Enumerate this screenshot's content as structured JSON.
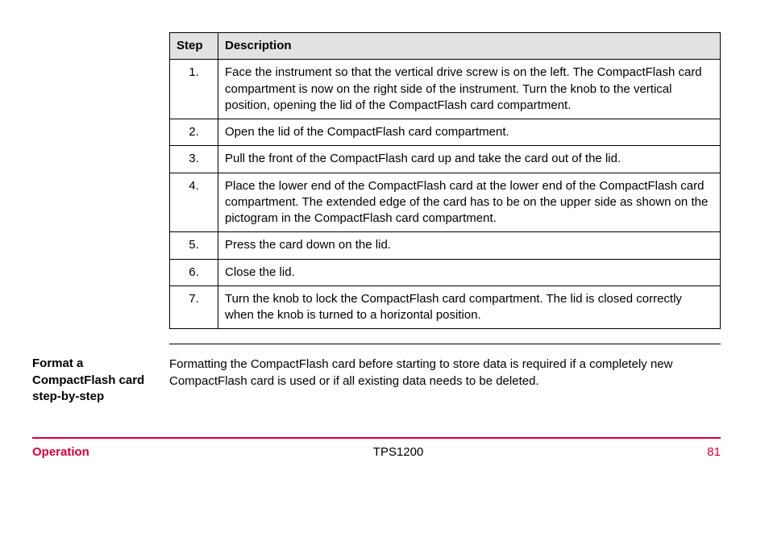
{
  "table": {
    "headers": [
      "Step",
      "Description"
    ],
    "rows": [
      {
        "step": "1.",
        "desc": "Face the instrument so that the vertical drive screw is on the left. The CompactFlash card compartment is now on the right side of the instrument. Turn the knob to the vertical position, opening the lid of the CompactFlash card compartment."
      },
      {
        "step": "2.",
        "desc": "Open the lid of the CompactFlash card compartment."
      },
      {
        "step": "3.",
        "desc": "Pull the front of the CompactFlash card up and take the card out of the lid."
      },
      {
        "step": "4.",
        "desc": "Place the lower end of the CompactFlash card at the lower end of the CompactFlash card compartment. The extended edge of the card has to be on the upper side as shown on the pictogram in the CompactFlash card compartment."
      },
      {
        "step": "5.",
        "desc": "Press the card down on the lid."
      },
      {
        "step": "6.",
        "desc": "Close the lid."
      },
      {
        "step": "7.",
        "desc": "Turn the knob to lock the CompactFlash card compartment. The lid is closed correctly when the knob is turned to a horizontal position."
      }
    ]
  },
  "section": {
    "heading": "Format a CompactFlash card step-by-step",
    "body": "Formatting the CompactFlash card before starting to store data is required if a completely new CompactFlash card is used or if all existing data needs to be deleted."
  },
  "footer": {
    "left": "Operation",
    "center": "TPS1200",
    "right": "81"
  }
}
